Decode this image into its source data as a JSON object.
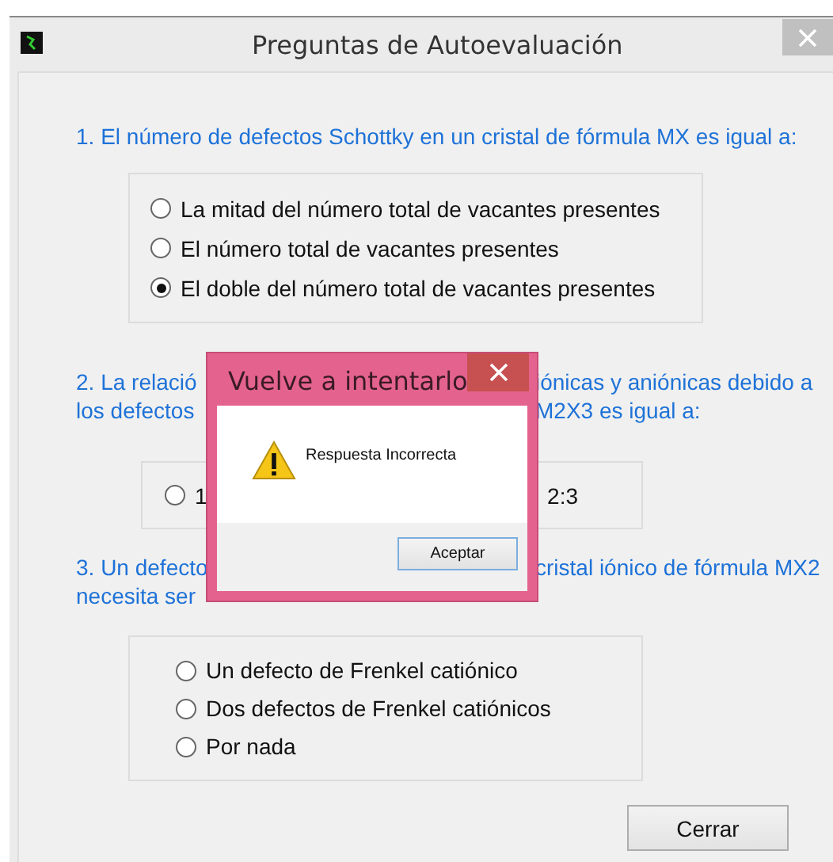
{
  "window": {
    "title": "Preguntas de Autoevaluación"
  },
  "questions": [
    {
      "kind": "full",
      "text": "1.  El número de defectos Schottky en un cristal  de fórmula MX es igual a:",
      "options": [
        {
          "label": "La mitad del número total de vacantes presentes",
          "selected": false
        },
        {
          "label": "El número total de vacantes presentes",
          "selected": false
        },
        {
          "label": "El doble del número total de vacantes presentes",
          "selected": true
        }
      ]
    },
    {
      "kind": "split",
      "lines": [
        {
          "left": "2.  La relació",
          "right": "iónicas y aniónicas debido a"
        },
        {
          "left": "los defectos",
          "right": "M2X3 es igual a:"
        }
      ],
      "options": [
        {
          "label": "1",
          "selected": false
        },
        {
          "label": "2:3"
        }
      ]
    },
    {
      "kind": "split",
      "lines": [
        {
          "left": "3. Un defecto",
          "right": "cristal iónico de fórmula MX2"
        },
        {
          "left": "necesita ser"
        }
      ],
      "options": [
        {
          "label": "Un defecto de Frenkel catiónico",
          "selected": false
        },
        {
          "label": "Dos defectos de Frenkel catiónicos",
          "selected": false
        },
        {
          "label": "Por nada",
          "selected": false
        }
      ]
    }
  ],
  "close_button": "Cerrar",
  "dialog": {
    "title": "Vuelve a intentarlo",
    "message": "Respuesta Incorrecta",
    "button": "Aceptar"
  }
}
